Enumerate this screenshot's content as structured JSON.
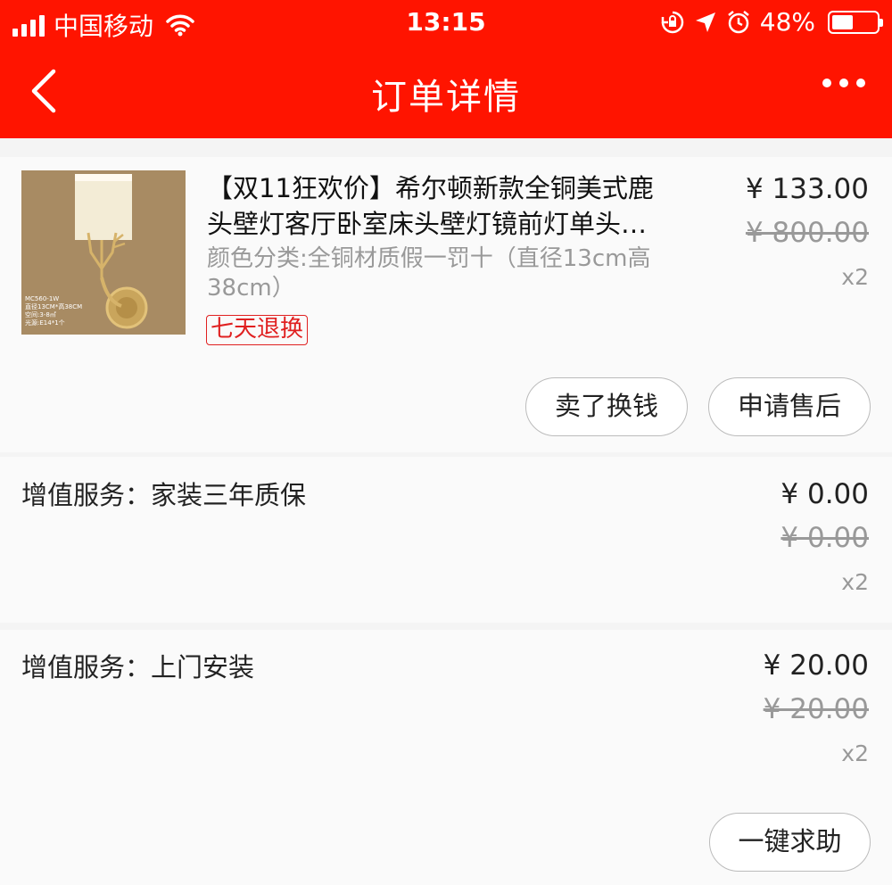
{
  "status_bar": {
    "carrier": "中国移动",
    "time": "13:15",
    "battery": "48%",
    "battery_level": 0.48
  },
  "nav": {
    "title": "订单详情",
    "icons": [
      "chevron-left-icon",
      "more-icon"
    ]
  },
  "product": {
    "name_line1": "【双11狂欢价】希尔顿新款全铜美式鹿",
    "name_line2": "头壁灯客厅卧室床头壁灯镜前灯单头…",
    "attributes": "颜色分类:全铜材质假一罚十（直径13cm高38cm）",
    "tag": "七天退换",
    "price": "¥ 133.00",
    "original_price": "¥ 800.00",
    "quantity": "x2",
    "image_label": "MC560-1W\n直径13CM*高38CM\n空间:3-8㎡\n光源:E14*1个",
    "buttons": {
      "sell": "卖了换钱",
      "after_sale": "申请售后"
    }
  },
  "services": [
    {
      "label": "增值服务：家装三年质保",
      "price": "¥ 0.00",
      "original_price": "¥ 0.00",
      "quantity": "x2"
    },
    {
      "label": "增值服务：上门安装",
      "price": "¥ 20.00",
      "original_price": "¥ 20.00",
      "quantity": "x2"
    }
  ],
  "help_button": "一键求助",
  "colors": {
    "header": "#ff1400",
    "tag": "#e02020",
    "background": "#f4f4f4",
    "card": "#fafafa"
  }
}
